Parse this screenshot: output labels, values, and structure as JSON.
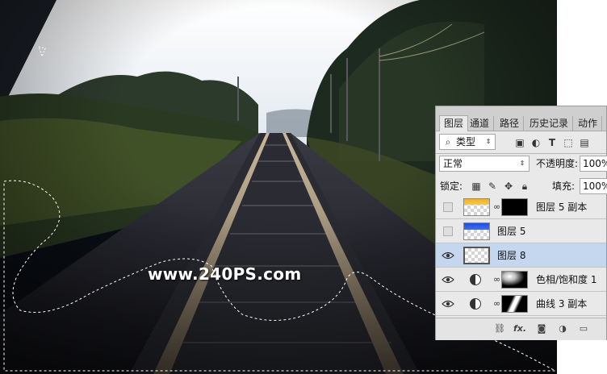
{
  "watermark": "www.240PS.com",
  "layers_panel": {
    "tabs": [
      "图层",
      "通道",
      "路径",
      "历史记录",
      "动作"
    ],
    "active_tab": "图层",
    "filter": {
      "icon": "search-icon",
      "label": "类型",
      "filter_icons": [
        "image-filter-icon",
        "adjustment-filter-icon",
        "type-filter-icon",
        "shape-filter-icon",
        "smart-object-filter-icon"
      ]
    },
    "blend_mode": "正常",
    "opacity_label": "不透明度:",
    "opacity_value": "100%",
    "lock_label": "锁定:",
    "lock_icons": [
      "lock-transparent-icon",
      "lock-brush-icon",
      "lock-move-icon",
      "lock-all-icon"
    ],
    "fill_label": "填充:",
    "fill_value": "100%",
    "layers": [
      {
        "name": "图层 5 副本",
        "visible": false,
        "selected": false,
        "thumb": "yellow",
        "has_mask": true
      },
      {
        "name": "图层 5",
        "visible": false,
        "selected": false,
        "thumb": "blue",
        "has_mask": false
      },
      {
        "name": "图层 8",
        "visible": true,
        "selected": true,
        "thumb": "transparent",
        "has_mask": false
      },
      {
        "name": "色相/饱和度 1",
        "visible": true,
        "selected": false,
        "thumb": "adjustment",
        "has_mask": true
      },
      {
        "name": "曲线 3 副本",
        "visible": true,
        "selected": false,
        "thumb": "adjustment",
        "has_mask": true
      }
    ],
    "bottom_icons": [
      "link-layers-icon",
      "fx-icon",
      "add-mask-icon",
      "new-adjustment-icon",
      "new-group-icon"
    ],
    "bottom_fx_label": "fx."
  },
  "colors": {
    "panel_bg": "#e9e9e9",
    "selected_layer": "#c5d7ef",
    "sky": "#eef1f4"
  }
}
